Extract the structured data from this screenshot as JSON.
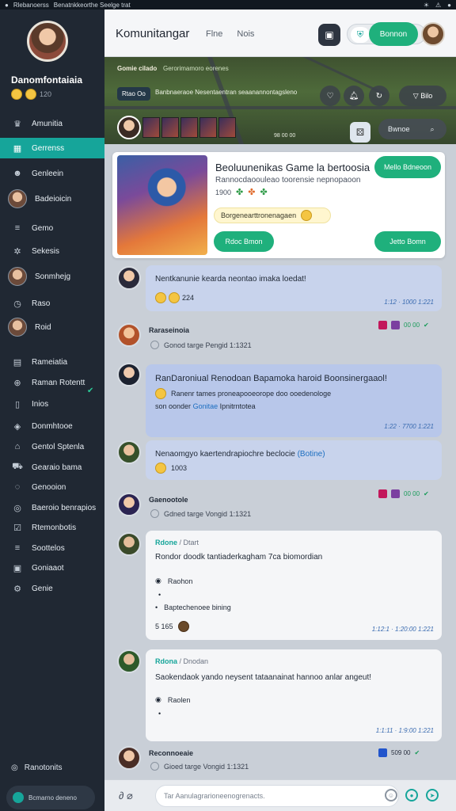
{
  "status_bar": {
    "title": "Rlebanoerss",
    "subtitle": "Benatnkkeorthe Seelge trat"
  },
  "sidebar": {
    "username": "Danomfontaiaia",
    "stat": "120",
    "items": [
      {
        "label": "Amunitia",
        "icon": "hat-icon"
      },
      {
        "label": "Gerrenss",
        "icon": "grid-icon"
      },
      {
        "label": "Genleein",
        "icon": "user-icon"
      },
      {
        "label": "Badeioicin",
        "icon": "avatar"
      },
      {
        "label": "Gemo",
        "icon": "list-icon"
      },
      {
        "label": "Sekesis",
        "icon": "gear-icon"
      },
      {
        "label": "Sonmhejg",
        "icon": "avatar"
      },
      {
        "label": "Raso",
        "icon": "clock-icon"
      },
      {
        "label": "Roid",
        "icon": "avatar"
      },
      {
        "label": "Rameiatia",
        "icon": "doc-icon"
      },
      {
        "label": "Raman Rotentt",
        "icon": "globe-icon"
      },
      {
        "label": "Inios",
        "icon": "book-icon"
      },
      {
        "label": "Donmhtooe",
        "icon": "gem-icon"
      },
      {
        "label": "Gentol Sptenla",
        "icon": "store-icon"
      },
      {
        "label": "Gearaio bama",
        "icon": "car-icon"
      },
      {
        "label": "Genooion",
        "icon": "chat-icon"
      },
      {
        "label": "Baeroio benrapios",
        "icon": "target-icon"
      },
      {
        "label": "Rtemonbotis",
        "icon": "check-icon"
      },
      {
        "label": "Soottelos",
        "icon": "list-icon"
      },
      {
        "label": "Goniaaot",
        "icon": "image-icon"
      },
      {
        "label": "Genie",
        "icon": "settings-icon"
      }
    ],
    "bottom_item": "Ranotonits",
    "footer": "Bcmarno deneno"
  },
  "topbar": {
    "title": "Komunitangar",
    "links": [
      "Flne",
      "Nois"
    ],
    "button": "Bonnon"
  },
  "banner": {
    "title": "Gomie cilado",
    "subtitle": "Gerorimamoro eorenes",
    "tag": "Rtao Oo",
    "desc": "Banbnaeraoe Nesentaentran seaanannontagsleno",
    "pill": "Bilo",
    "count": "98 00 00",
    "search": "Bwnoe"
  },
  "card": {
    "title": "Beoluunenikas Game la bertoosia",
    "subtitle": "Rannocdaoouleao toorensie nepnopaoon",
    "meta": "1900",
    "tip": "Borgenearttronenagaen",
    "button1": "Rdoc Bmon",
    "button2": "Jetto Bomn",
    "button3": "Mello Bdneoon"
  },
  "feed": [
    {
      "type": "bubble",
      "text": "Nentkanunie kearda neontao imaka loedat!",
      "reactions": "224",
      "time": "1:12 · 1000 1:221"
    },
    {
      "type": "row",
      "name": "Raraseinoia",
      "meta": "Gonod targe Pengid 1:1321",
      "badges": "00 00"
    },
    {
      "type": "bubble",
      "text": "RanDaroniual Renodoan Bapamoka haroid Boonsinergaaol!",
      "text2": "Ranenr tames proneapooeorope doo ooedenologe",
      "text3": "son oonder",
      "link": "Gonitae",
      "text4": "Ipnitrntotea",
      "time": "1:22 · 7700 1:221"
    },
    {
      "type": "bubble",
      "text": "Nenaomgyo kaertendrapiochre beclocie",
      "link": "(Botine)",
      "reactions": "1003"
    },
    {
      "type": "row",
      "name": "Gaenootole",
      "meta": "Gdned targe Vongid 1:1321",
      "badges": "00 00"
    },
    {
      "type": "card",
      "name": "Rdone",
      "role": "/ Dtart",
      "text": "Rondor doodk tantiaderkagham 7ca biomordian",
      "opt1": "Raohon",
      "opt2": "Baptechenoee bining",
      "count": "5 165",
      "time": "1:12:1 · 1:20:00 1:221"
    },
    {
      "type": "card",
      "name": "Rdona",
      "role": "/ Dnodan",
      "text": "Saokendaok yando neysent tataanainat hannoo anlar angeut!",
      "opt1": "Raolen",
      "time": "1:1:11 · 1:9:00 1:221"
    },
    {
      "type": "row",
      "name": "Reconnoeaie",
      "meta": "Gioed targe Vongid 1:1321",
      "badges": "509 00"
    }
  ],
  "composer": {
    "placeholder": "Tar Aanulagrarioneenogrenacts."
  },
  "colors": {
    "accent": "#16a59a",
    "button": "#1fb07c",
    "sidebar": "#202833"
  }
}
